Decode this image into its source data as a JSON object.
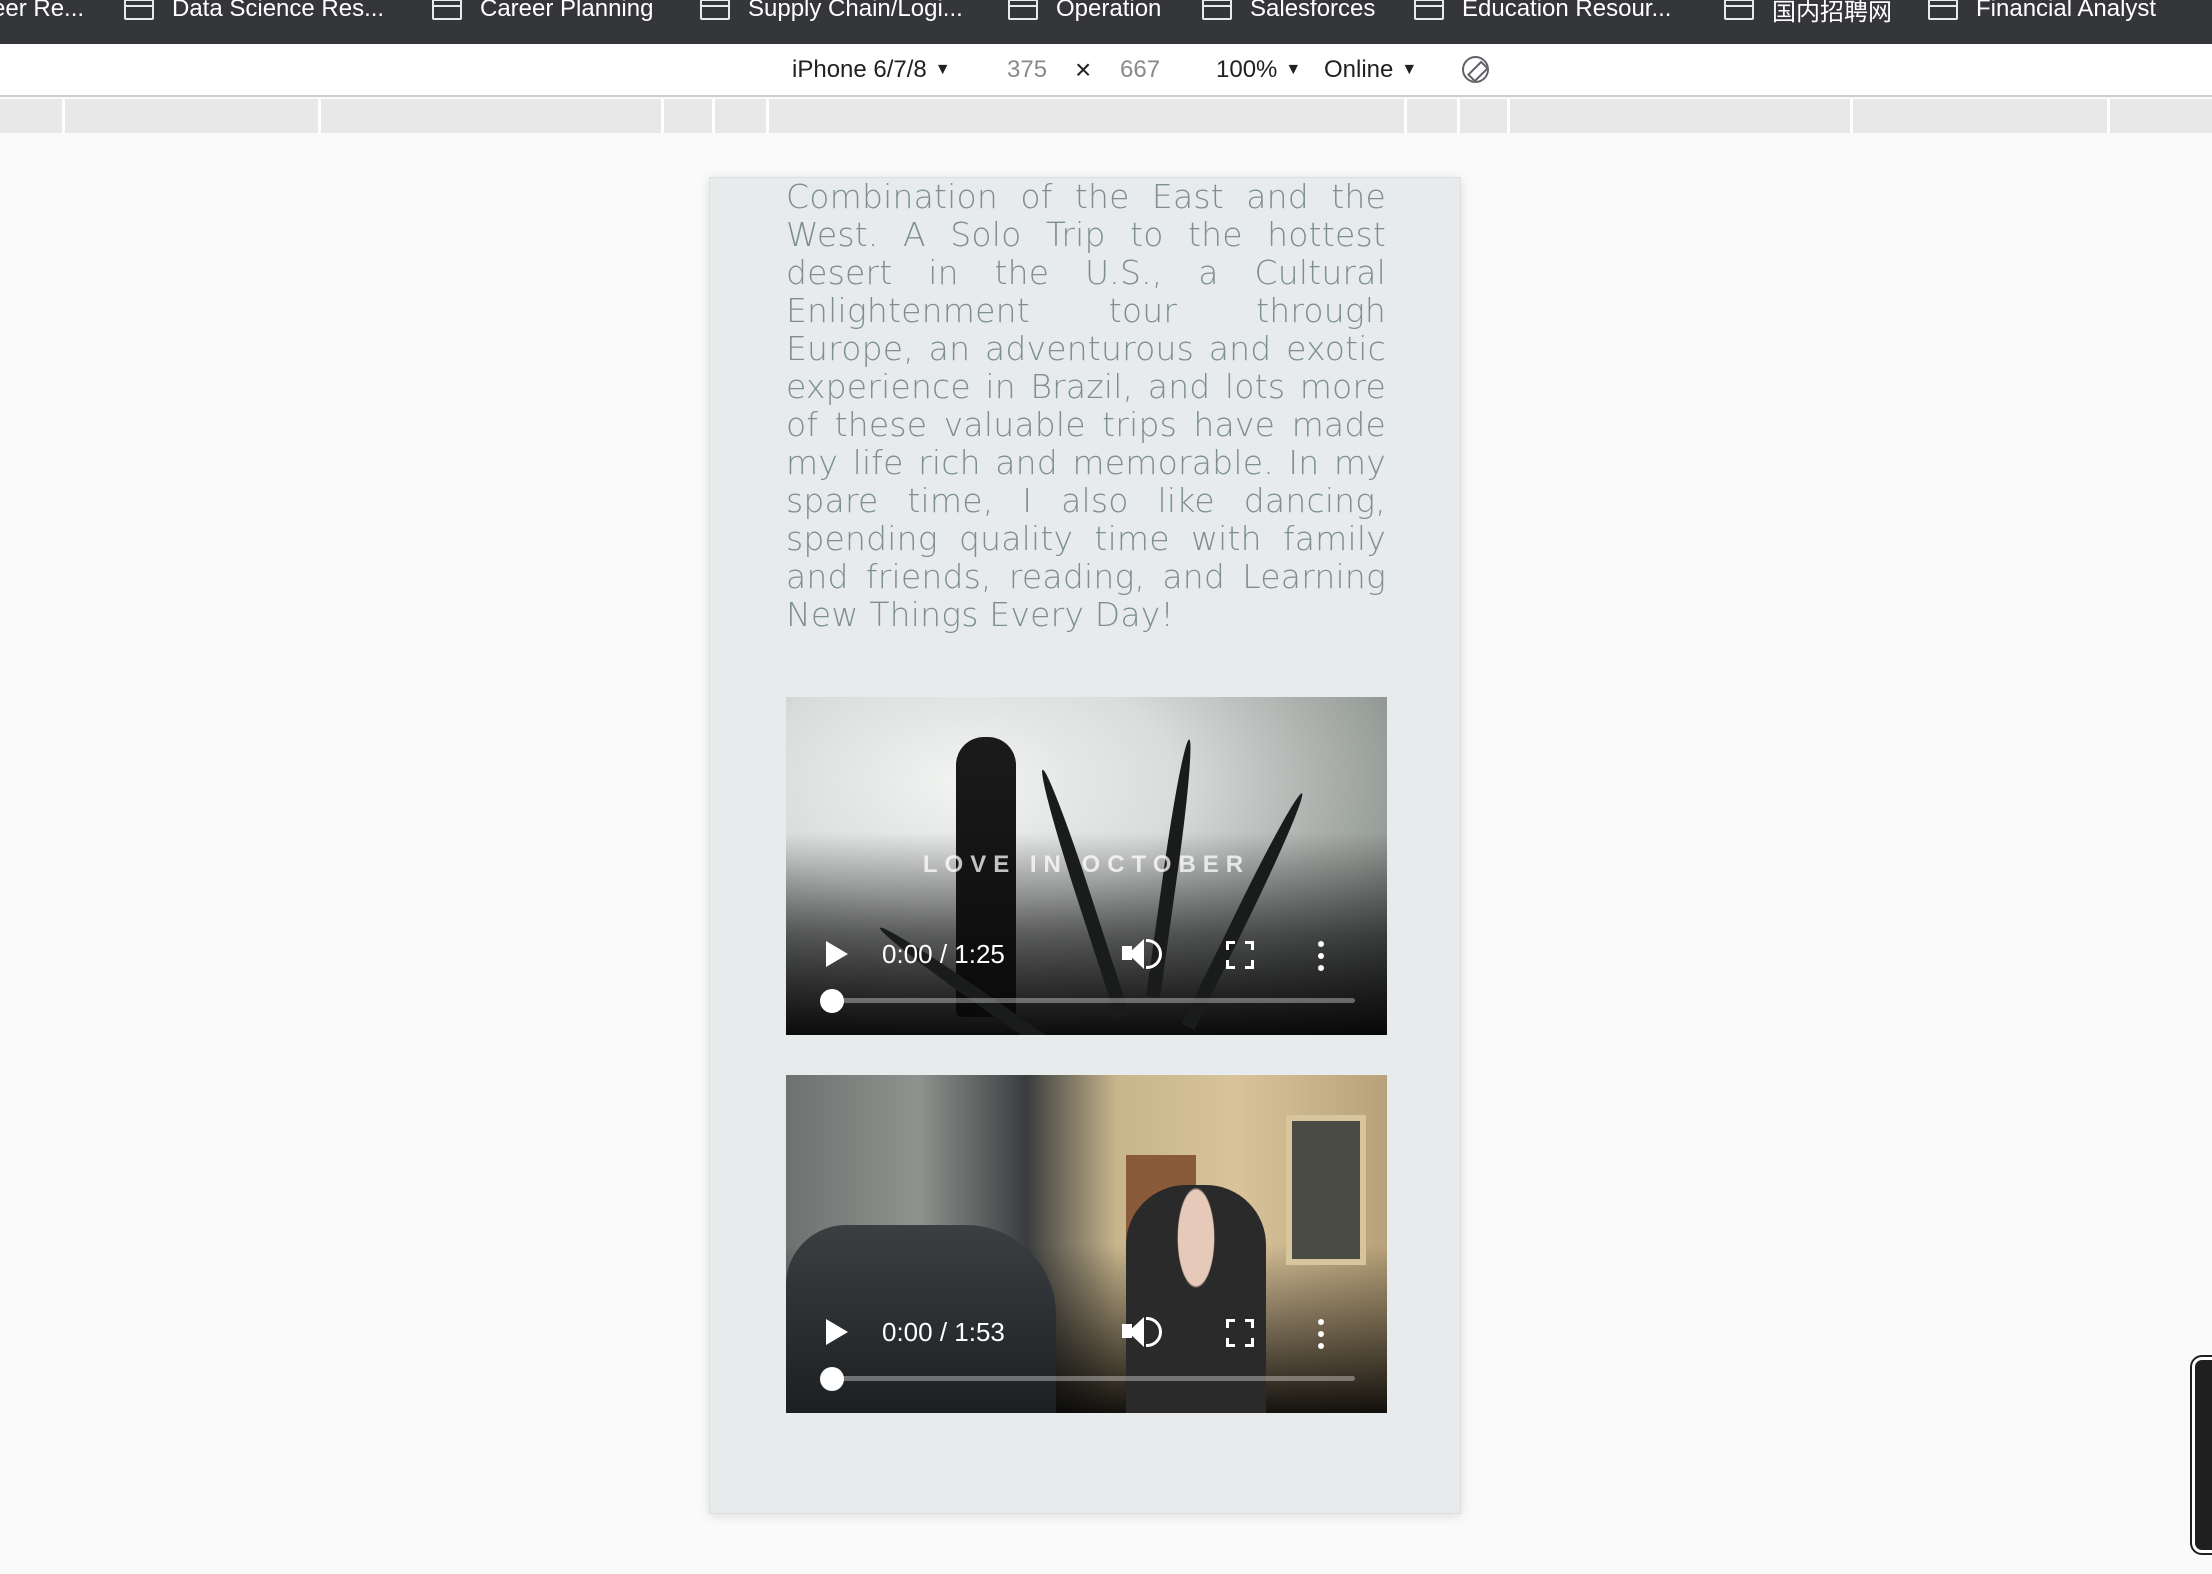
{
  "bookmarks": [
    {
      "label": "eer Re...",
      "icon": "folder-icon"
    },
    {
      "label": "Data Science Res...",
      "icon": "folder-icon"
    },
    {
      "label": "Career Planning",
      "icon": "folder-icon"
    },
    {
      "label": "Supply Chain/Logi...",
      "icon": "folder-icon"
    },
    {
      "label": "Operation",
      "icon": "folder-icon"
    },
    {
      "label": "Salesforces",
      "icon": "folder-icon"
    },
    {
      "label": "Education Resour...",
      "icon": "folder-icon"
    },
    {
      "label": "国内招聘网",
      "icon": "folder-icon"
    },
    {
      "label": "Financial Analyst",
      "icon": "folder-icon"
    }
  ],
  "device_toolbar": {
    "device": "iPhone 6/7/8",
    "width": "375",
    "separator": "×",
    "height": "667",
    "zoom": "100%",
    "throttle": "Online",
    "caret": "▼",
    "rotate_icon": "rotate-icon"
  },
  "page": {
    "bio_text": "Combination of the East and the West. A Solo Trip to the hottest desert in the U.S., a Cultural Enlightenment tour through Europe, an adventurous and exotic experience in Brazil, and lots more of these valuable trips have made my life rich and memorable. In my spare time, I also like dancing, spending quality time with family and friends, reading, and Learning New Things Every Day!",
    "videos": [
      {
        "overlay_title": "LOVE IN OCTOBER",
        "time": "0:00 / 1:25",
        "progress": 0
      },
      {
        "overlay_title": "",
        "time": "0:00 / 1:53",
        "progress": 0
      }
    ]
  },
  "colors": {
    "bookmarks_bg": "#35363a",
    "device_bg": "#e8ebeb",
    "bio_text": "#7d8f8f"
  }
}
